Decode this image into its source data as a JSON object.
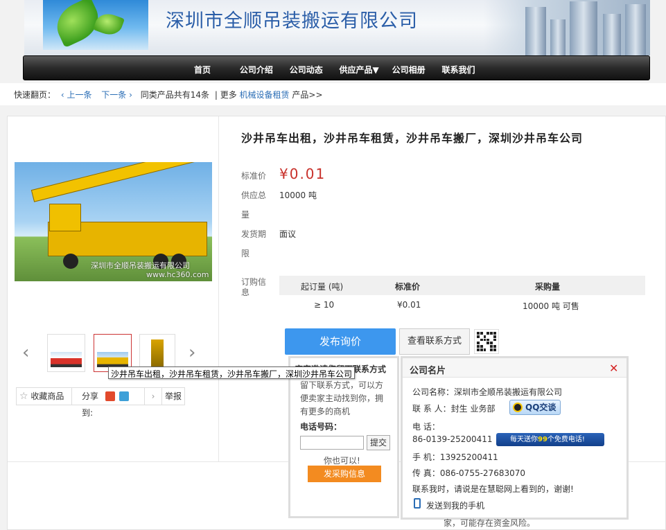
{
  "banner": {
    "company_title": "深圳市全顺吊装搬运有限公司"
  },
  "nav": {
    "items": [
      "首页",
      "公司介绍",
      "公司动态",
      "供应产品▼",
      "公司相册",
      "联系我们"
    ]
  },
  "quick_nav": {
    "label": "快速翻页：",
    "prev": "‹ 上一条",
    "next": "下一条 ›",
    "same_count": "同类产品共有14条",
    "more_prefix": "| 更多",
    "more_link": "机械设备租赁",
    "more_suffix": "产品>>"
  },
  "product": {
    "title": "沙井吊车出租，沙井吊车租赁，沙井吊车搬厂，深圳沙井吊车公司",
    "watermark_line1": "深圳市全顺吊装搬运有限公司",
    "watermark_line2": "www.hc360.com",
    "tooltip": "沙井吊车出租，沙井吊车租赁，沙井吊车搬厂，深圳沙井吊车公司",
    "price_label": "标准价",
    "price": "¥0.01",
    "supply_label_1": "供应总",
    "supply_label_2": "量",
    "supply_value": "10000 吨",
    "delivery_label_1": "发货期",
    "delivery_label_2": "限",
    "delivery_value": "面议",
    "order_label_1": "订购信",
    "order_label_2": "息"
  },
  "order_table": {
    "headers": [
      "起订量 (吨)",
      "标准价",
      "采购量"
    ],
    "row": [
      "≥ 10",
      "¥0.01",
      "10000 吨 可售"
    ]
  },
  "actions": {
    "favorite": "收藏商品",
    "share": "分享到:",
    "report": "举报",
    "inquiry": "发布询价",
    "view_contact": "查看联系方式"
  },
  "left_popup": {
    "title": "店家邀请您留下联系方式",
    "desc": "留下联系方式，可以方便卖家主动找到你，拥有更多的商机",
    "phone_label": "电话号码：",
    "submit": "提交",
    "also": "你也可以!",
    "post_purchase": "发采购信息"
  },
  "card": {
    "title": "公司名片",
    "company_line": "公司名称：深圳市全顺吊装搬运有限公司",
    "contact_line": "联 系 人：封生   业务部",
    "qq_label": "QQ交谈",
    "tel_label": "电    话：",
    "tel_value": "86-0139-25200411",
    "call_banner_a": "每天送你",
    "call_banner_b": "99",
    "call_banner_c": "个免费电话!",
    "mobile_line": "手    机：13925200411",
    "fax_line": "传    真：086-0755-27683070",
    "note": "联系我时，请说是在慧聪网上看到的，谢谢!",
    "send_phone": "发送到我的手机"
  },
  "footer_partial": "家，可能存在资金风险。",
  "colors": {
    "price_red": "#c8302a",
    "inquiry_blue": "#3d97ee",
    "link_blue": "#2a6db5",
    "buy_orange": "#f38b20"
  }
}
